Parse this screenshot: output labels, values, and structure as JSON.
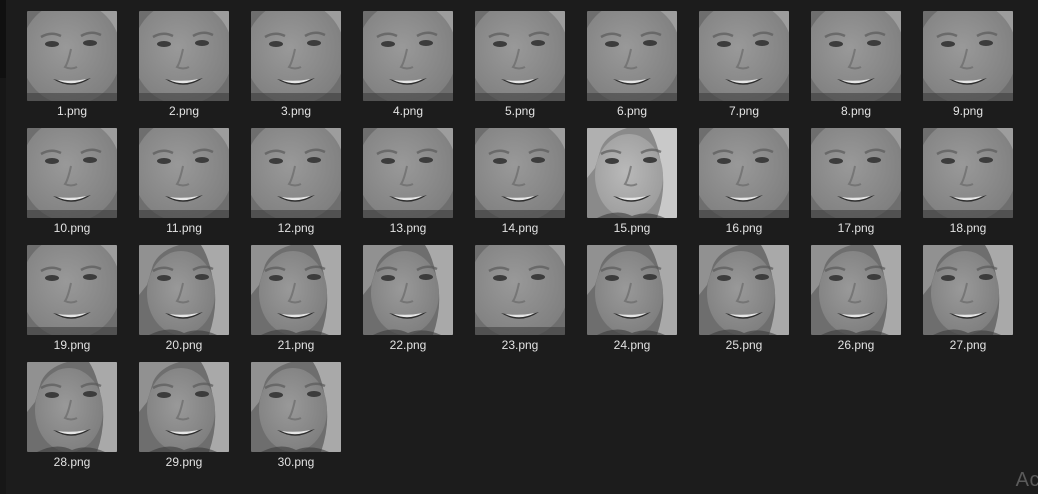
{
  "files": [
    {
      "name": "1.png",
      "variant": "wide"
    },
    {
      "name": "2.png",
      "variant": "wide"
    },
    {
      "name": "3.png",
      "variant": "wide"
    },
    {
      "name": "4.png",
      "variant": "wide"
    },
    {
      "name": "5.png",
      "variant": "wide"
    },
    {
      "name": "6.png",
      "variant": "wide"
    },
    {
      "name": "7.png",
      "variant": "wide"
    },
    {
      "name": "8.png",
      "variant": "wide"
    },
    {
      "name": "9.png",
      "variant": "wide"
    },
    {
      "name": "10.png",
      "variant": "wide"
    },
    {
      "name": "11.png",
      "variant": "wide"
    },
    {
      "name": "12.png",
      "variant": "wide"
    },
    {
      "name": "13.png",
      "variant": "wide"
    },
    {
      "name": "14.png",
      "variant": "wide"
    },
    {
      "name": "15.png",
      "variant": "bright"
    },
    {
      "name": "16.png",
      "variant": "wide"
    },
    {
      "name": "17.png",
      "variant": "wide"
    },
    {
      "name": "18.png",
      "variant": "wide"
    },
    {
      "name": "19.png",
      "variant": "wide"
    },
    {
      "name": "20.png",
      "variant": "full"
    },
    {
      "name": "21.png",
      "variant": "full"
    },
    {
      "name": "22.png",
      "variant": "full"
    },
    {
      "name": "23.png",
      "variant": "wide"
    },
    {
      "name": "24.png",
      "variant": "full"
    },
    {
      "name": "25.png",
      "variant": "full"
    },
    {
      "name": "26.png",
      "variant": "full"
    },
    {
      "name": "27.png",
      "variant": "full"
    },
    {
      "name": "28.png",
      "variant": "full"
    },
    {
      "name": "29.png",
      "variant": "full"
    },
    {
      "name": "30.png",
      "variant": "full"
    }
  ],
  "watermark": "Ac",
  "colors": {
    "background": "#1c1c1c",
    "caption": "#e2e2e2"
  }
}
